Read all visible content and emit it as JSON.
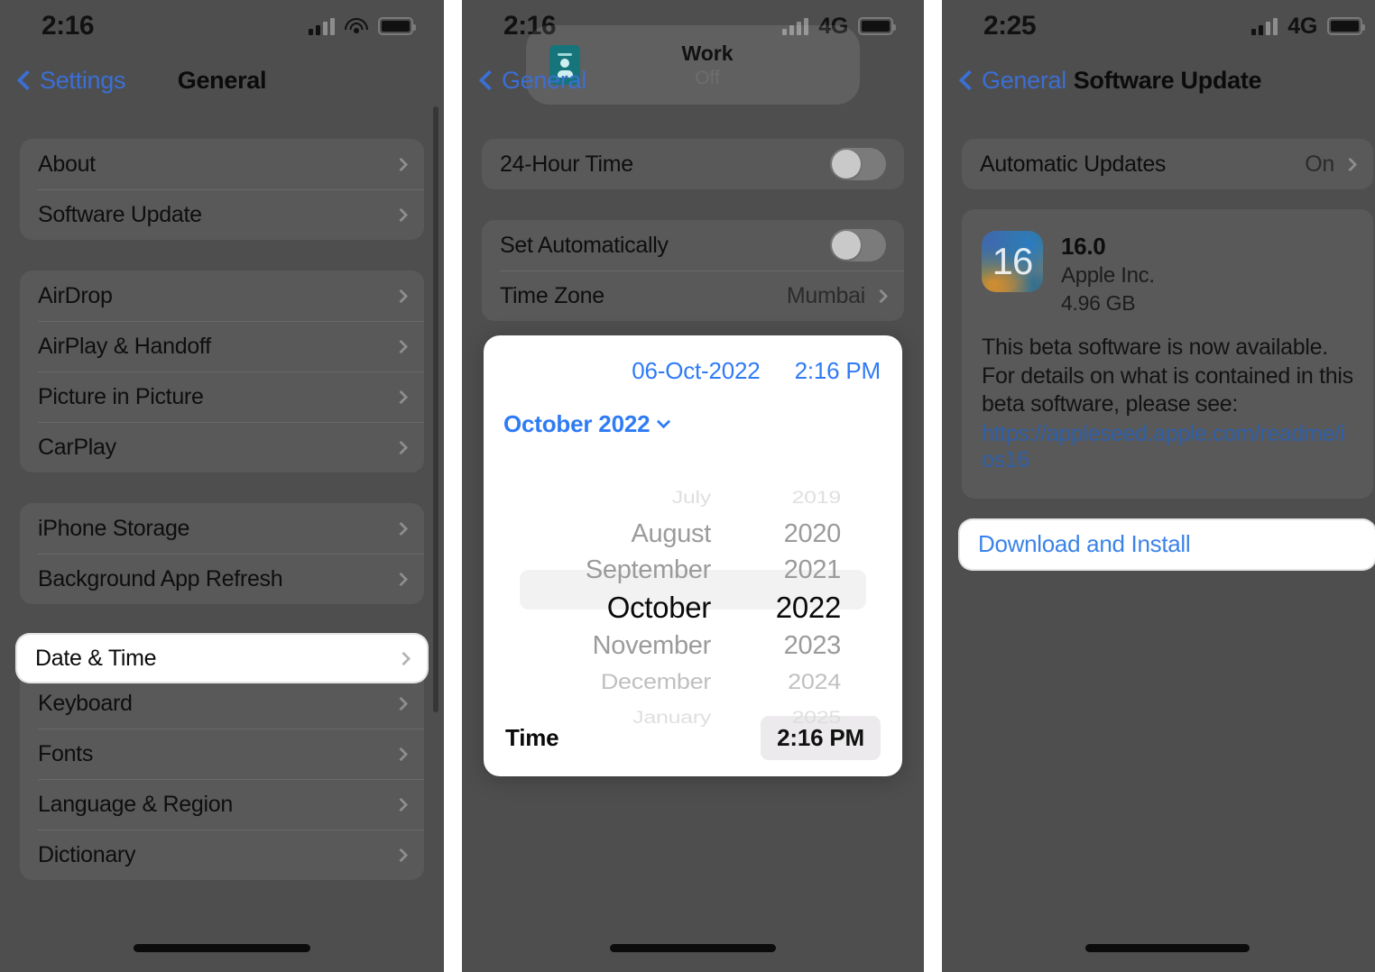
{
  "panel1": {
    "status_bar": {
      "time": "2:16",
      "signal_icon": "cellular-signal-icon",
      "wifi_icon": "wifi-icon",
      "battery_icon": "battery-icon"
    },
    "nav": {
      "back_label": "Settings",
      "title": "General",
      "back_icon": "chevron-left-icon"
    },
    "groups": [
      {
        "rows": [
          {
            "label": "About",
            "accessory": "chevron-right-icon"
          },
          {
            "label": "Software Update",
            "accessory": "chevron-right-icon"
          }
        ]
      },
      {
        "rows": [
          {
            "label": "AirDrop",
            "accessory": "chevron-right-icon"
          },
          {
            "label": "AirPlay & Handoff",
            "accessory": "chevron-right-icon"
          },
          {
            "label": "Picture in Picture",
            "accessory": "chevron-right-icon"
          },
          {
            "label": "CarPlay",
            "accessory": "chevron-right-icon"
          }
        ]
      },
      {
        "rows": [
          {
            "label": "iPhone Storage",
            "accessory": "chevron-right-icon"
          },
          {
            "label": "Background App Refresh",
            "accessory": "chevron-right-icon"
          }
        ]
      }
    ],
    "highlighted_row": {
      "label": "Date & Time",
      "accessory": "chevron-right-icon"
    },
    "rows_after_highlight": [
      {
        "label": "Keyboard",
        "accessory": "chevron-right-icon"
      },
      {
        "label": "Fonts",
        "accessory": "chevron-right-icon"
      },
      {
        "label": "Language & Region",
        "accessory": "chevron-right-icon"
      },
      {
        "label": "Dictionary",
        "accessory": "chevron-right-icon"
      }
    ]
  },
  "panel2": {
    "status_bar": {
      "time": "2:16",
      "network": "4G",
      "signal_icon": "cellular-signal-icon",
      "battery_icon": "battery-icon"
    },
    "nav": {
      "back_label": "General",
      "back_icon": "chevron-left-icon"
    },
    "focus_banner": {
      "title": "Work",
      "subtitle": "Off",
      "icon": "work-focus-badge-icon"
    },
    "rows": [
      {
        "label": "24-Hour Time",
        "control": "toggle",
        "state": "off"
      },
      {
        "label": "Set Automatically",
        "control": "toggle",
        "state": "off"
      },
      {
        "label": "Time Zone",
        "value": "Mumbai",
        "accessory": "chevron-right-icon"
      }
    ],
    "picker": {
      "date_value": "06-Oct-2022",
      "time_value": "2:16 PM",
      "month_header": "October 2022",
      "header_icon": "chevron-down-icon",
      "months": [
        "July",
        "August",
        "September",
        "October",
        "November",
        "December",
        "January"
      ],
      "years": [
        "2019",
        "2020",
        "2021",
        "2022",
        "2023",
        "2024",
        "2025"
      ],
      "selected_month": "October",
      "selected_year": "2022",
      "footer_label": "Time",
      "footer_value": "2:16 PM"
    }
  },
  "panel3": {
    "status_bar": {
      "time": "2:25",
      "network": "4G",
      "signal_icon": "cellular-signal-icon",
      "battery_icon": "battery-icon"
    },
    "nav": {
      "back_label": "General",
      "title": "Software Update",
      "back_icon": "chevron-left-icon"
    },
    "automatic_updates": {
      "label": "Automatic Updates",
      "value": "On",
      "accessory": "chevron-right-icon"
    },
    "update": {
      "icon_label": "16",
      "version": "16.0",
      "vendor": "Apple Inc.",
      "size": "4.96 GB",
      "description": "This beta software is now available. For details on what is contained in this beta software, please see:",
      "link": "https://appleseed.apple.com/readme/ios16"
    },
    "download_button": {
      "label": "Download and Install"
    }
  },
  "colors": {
    "accent_blue": "#2f7bf6",
    "link_blue": "#3b83e8",
    "nav_blue": "#3b6fd4",
    "dimmed_bg": "#4e4e4e",
    "row_bg": "#595959",
    "highlight_white": "#ffffff"
  }
}
